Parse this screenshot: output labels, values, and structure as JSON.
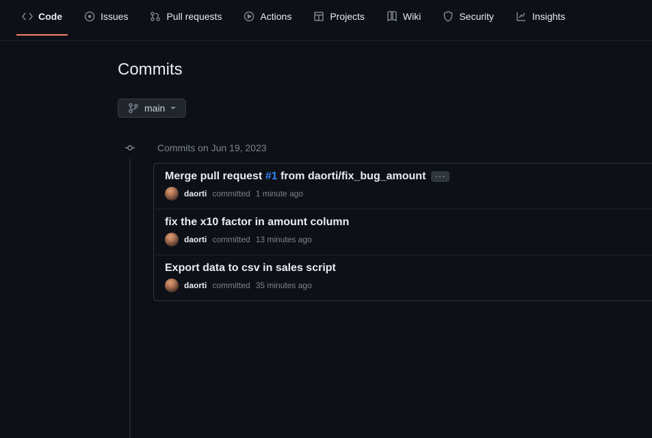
{
  "nav": {
    "code": "Code",
    "issues": "Issues",
    "pulls": "Pull requests",
    "actions": "Actions",
    "projects": "Projects",
    "wiki": "Wiki",
    "security": "Security",
    "insights": "Insights"
  },
  "page_title": "Commits",
  "branch": {
    "name": "main"
  },
  "timeline": {
    "date_label": "Commits on Jun 19, 2023"
  },
  "commits": [
    {
      "title_prefix": "Merge pull request ",
      "pr_ref": "#1",
      "title_suffix": " from daorti/fix_bug_amount",
      "has_ellipsis": true,
      "author": "daorti",
      "action": "committed",
      "time": "1 minute ago"
    },
    {
      "title": "fix the x10 factor in amount column",
      "author": "daorti",
      "action": "committed",
      "time": "13 minutes ago"
    },
    {
      "title": "Export data to csv in sales script",
      "author": "daorti",
      "action": "committed",
      "time": "35 minutes ago"
    }
  ]
}
